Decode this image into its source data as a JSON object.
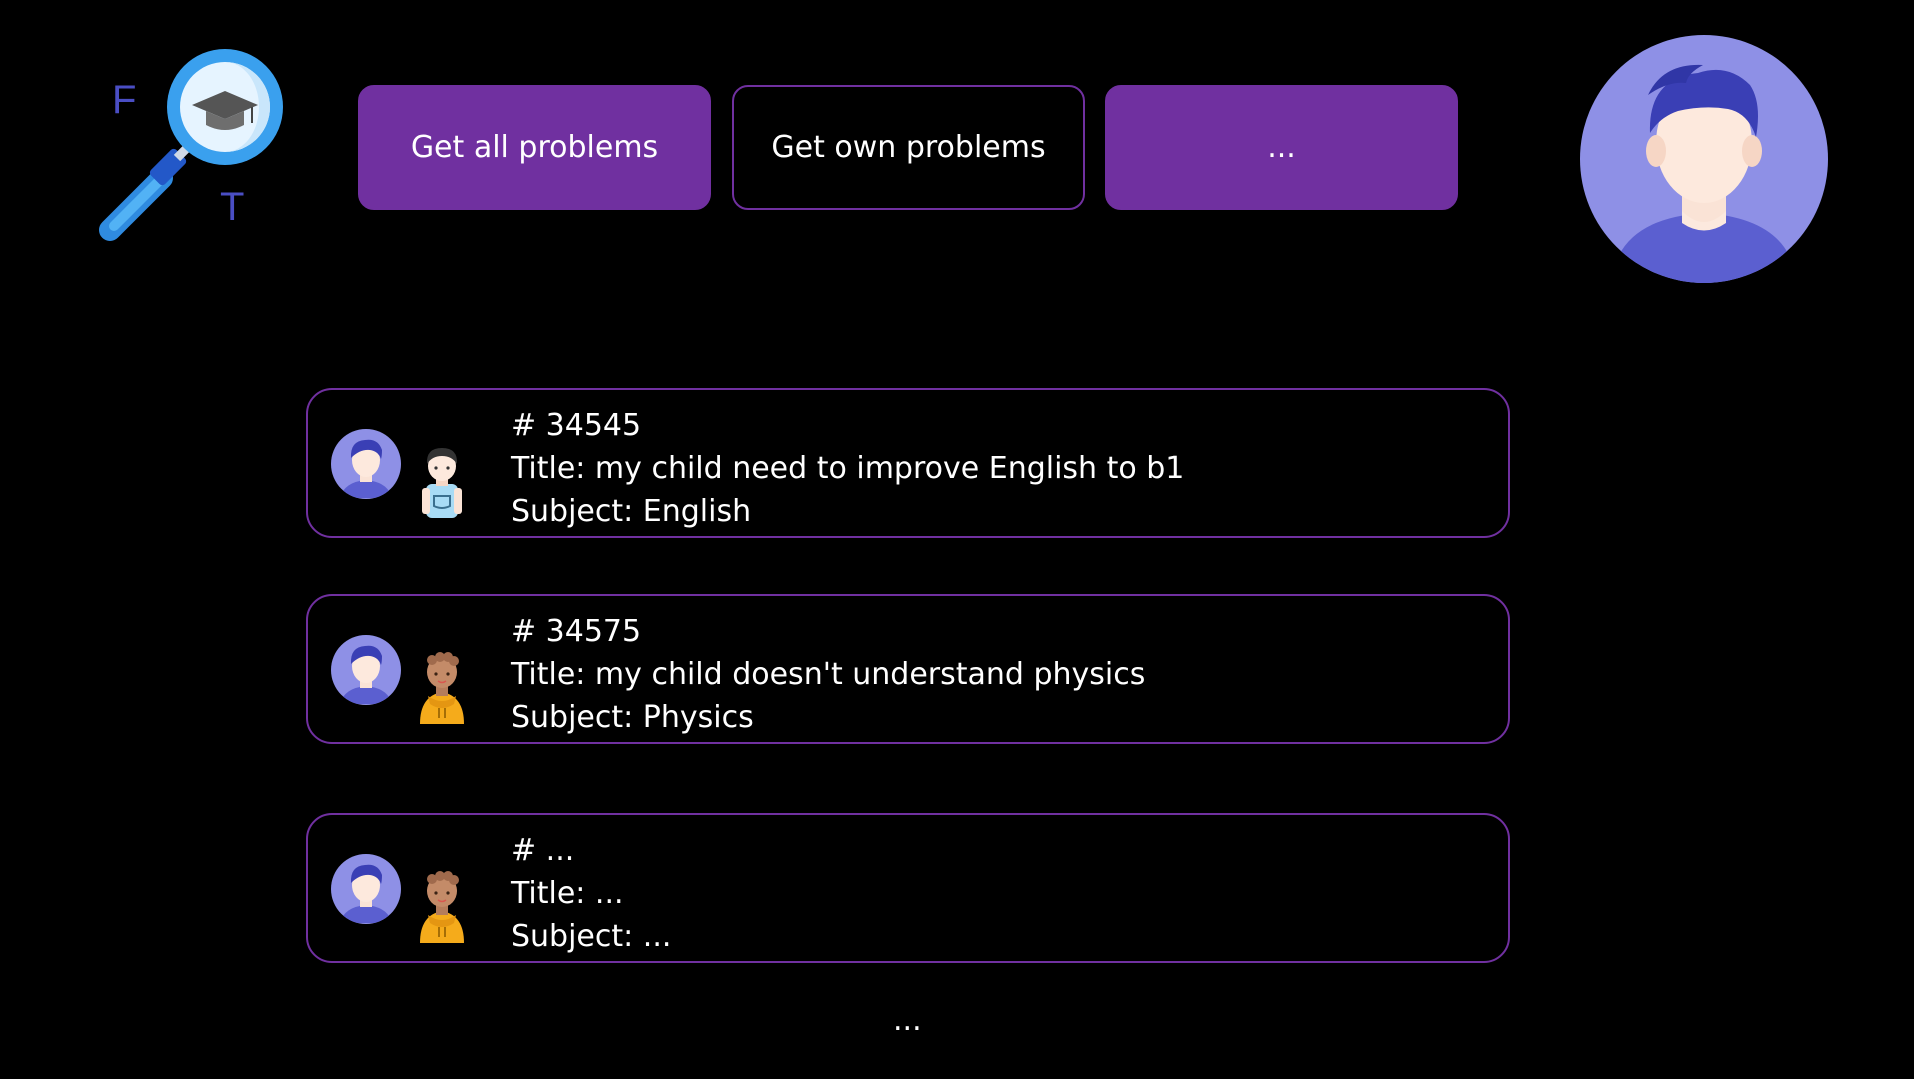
{
  "logo": {
    "icon": "magnifier-graduation-cap-icon",
    "letter_left": "F",
    "letter_right": "T"
  },
  "toolbar": {
    "get_all_label": "Get all problems",
    "get_own_label": "Get own problems",
    "more_label": "..."
  },
  "user": {
    "avatar_icon": "user-avatar-icon"
  },
  "problems": [
    {
      "id_line": "# 34545",
      "title_line": "Title: my child need to improve English to b1",
      "subject_line": "Subject: English",
      "child_icon": "child-boy-icon"
    },
    {
      "id_line": "# 34575",
      "title_line": "Title: my child doesn't understand physics",
      "subject_line": "Subject: Physics",
      "child_icon": "child-yellow-hoodie-icon"
    },
    {
      "id_line": "# ...",
      "title_line": "Title: ...",
      "subject_line": "Subject: ...",
      "child_icon": "child-yellow-hoodie-icon"
    }
  ],
  "list_more": "...",
  "colors": {
    "accent": "#7030a0",
    "background": "#000000",
    "avatar_bg": "#8e90e6",
    "avatar_hair": "#3a3fb5",
    "logo_blue": "#3aa0ee"
  }
}
